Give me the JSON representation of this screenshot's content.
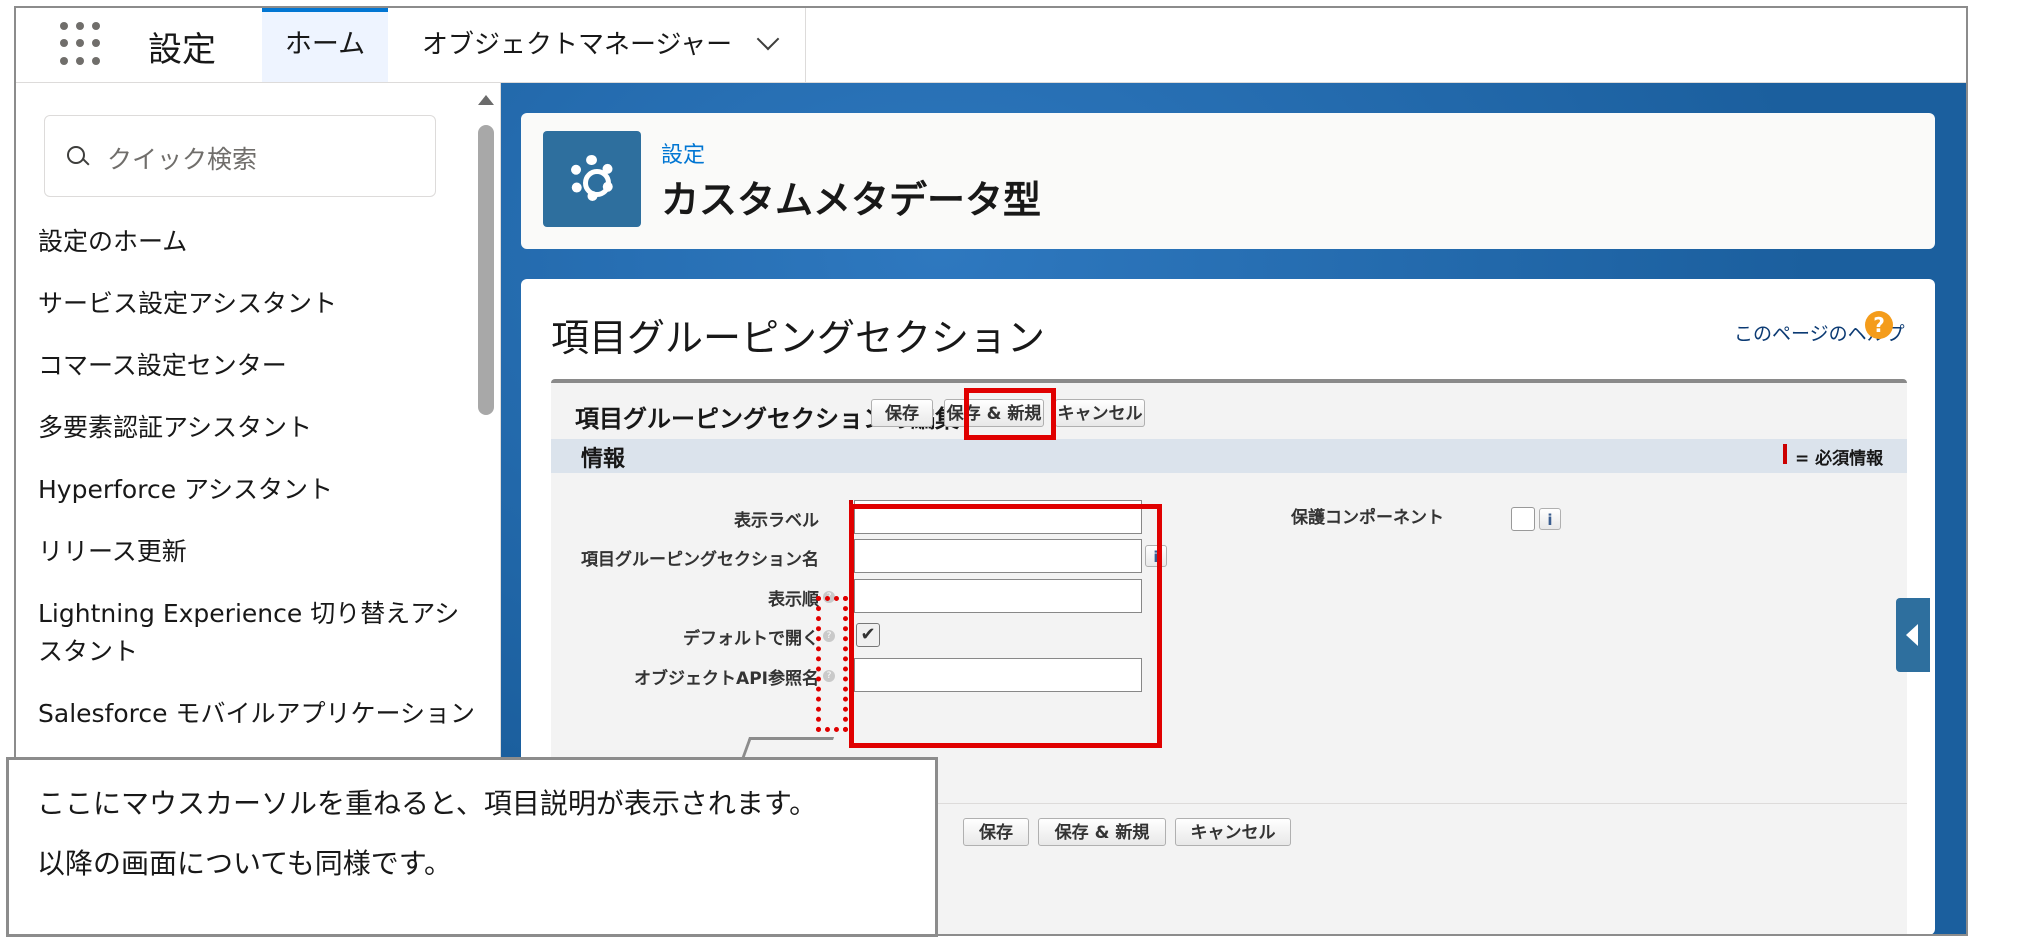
{
  "topbar": {
    "app_title": "設定",
    "tabs": [
      {
        "label": "ホーム",
        "active": true
      },
      {
        "label": "オブジェクトマネージャー",
        "has_dropdown": true
      }
    ]
  },
  "sidebar": {
    "search_placeholder": "クイック検索",
    "items": [
      "設定のホーム",
      "サービス設定アシスタント",
      "コマース設定センター",
      "多要素認証アシスタント",
      "Hyperforce アシスタント",
      "リリース更新",
      "Lightning Experience 切り替えアシスタント",
      "Salesforce モバイルアプリケーション"
    ]
  },
  "header": {
    "breadcrumb": "設定",
    "title": "カスタムメタデータ型",
    "icon": "gear-icon"
  },
  "page": {
    "title": "項目グルーピングセクション",
    "help_link": "このページのヘルプ",
    "help_icon": "?"
  },
  "edit": {
    "title": "項目グルーピングセクションの編集",
    "buttons": {
      "save": "保存",
      "save_new": "保存 & 新規",
      "cancel": "キャンセル"
    },
    "section_title": "情報",
    "required_legend": "= 必須情報",
    "fields": {
      "label": {
        "label": "表示ラベル",
        "value": ""
      },
      "name": {
        "label": "項目グルーピングセクション名",
        "value": ""
      },
      "order": {
        "label": "表示順",
        "value": ""
      },
      "default_open": {
        "label": "デフォルトで開く",
        "checked": true
      },
      "api_ref": {
        "label": "オブジェクトAPI参照名",
        "value": ""
      },
      "protected": {
        "label": "保護コンポーネント",
        "checked": false
      }
    },
    "info_glyph": "i",
    "check_glyph": "✔"
  },
  "callout": {
    "line1": "ここにマウスカーソルを重ねると、項目説明が表示されます。",
    "line2": "以降の画面についても同様です。"
  },
  "colors": {
    "accent": "#0176d3",
    "highlight": "#e00000",
    "required": "#cc0000"
  }
}
